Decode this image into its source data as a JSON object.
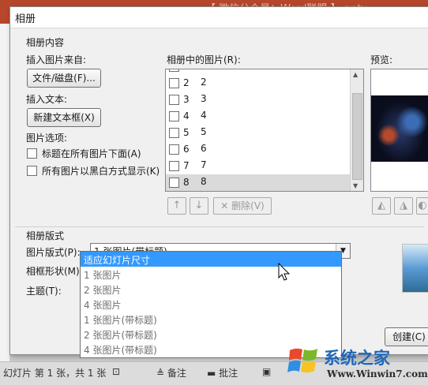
{
  "app": {
    "window_title": "【 微信公众号：Word联盟 】.pptx - PowerPoint"
  },
  "dialog": {
    "title": "相册",
    "album_content": "相册内容",
    "insert_from": "插入图片来自:",
    "file_disk_button": "文件/磁盘(F)...",
    "insert_text": "插入文本:",
    "new_textbox_button": "新建文本框(X)",
    "picture_options": "图片选项:",
    "caption_below": "标题在所有图片下面(A)",
    "all_bw": "所有图片以黑白方式显示(K)",
    "pictures_in_album": "相册中的图片(R):",
    "pictures": [
      {
        "index": "2",
        "name": "2"
      },
      {
        "index": "3",
        "name": "3"
      },
      {
        "index": "4",
        "name": "4"
      },
      {
        "index": "5",
        "name": "5"
      },
      {
        "index": "6",
        "name": "6"
      },
      {
        "index": "7",
        "name": "7"
      },
      {
        "index": "8",
        "name": "8"
      }
    ],
    "preview": "预览:",
    "delete_button": "删除(V)",
    "album_layout": "相册版式",
    "picture_layout_label": "图片版式(P):",
    "picture_layout_value": "1 张图片(带标题)",
    "frame_shape_label": "相框形状(M):",
    "theme_label": "主题(T):",
    "create_button": "创建(C)",
    "layout_options": [
      "适应幻灯片尺寸",
      "1 张图片",
      "2 张图片",
      "4 张图片",
      "1 张图片(带标题)",
      "2 张图片(带标题)",
      "4 张图片(带标题)"
    ]
  },
  "status": {
    "slide_info": "幻灯片 第 1 张，共 1 张",
    "notes": "备注",
    "comments": "批注"
  },
  "watermark": {
    "brand": "系统之家",
    "url": "Www.Winwin7.com"
  },
  "colors": {
    "accent": "#b7472a",
    "highlight": "#3399ff"
  }
}
